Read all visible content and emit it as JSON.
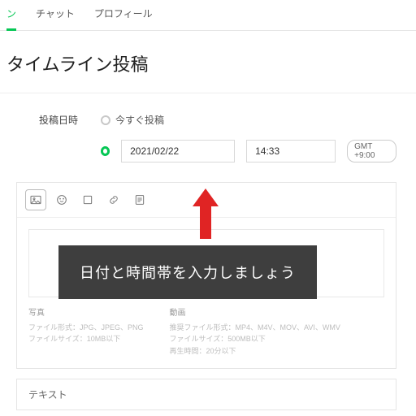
{
  "tabs": {
    "items": [
      "ン",
      "チャット",
      "プロフィール"
    ],
    "active": 0
  },
  "page_title": "タイムライン投稿",
  "post": {
    "label": "投稿日時",
    "option_now": "今すぐ投稿",
    "date": "2021/02/22",
    "time": "14:33",
    "gmt": "GMT +9:00"
  },
  "callout": "日付と時間帯を入力しましょう",
  "media": {
    "photo": {
      "title": "写真",
      "l1": "ファイル形式：JPG、JPEG、PNG",
      "l2": "ファイルサイズ：10MB以下"
    },
    "video": {
      "title": "動画",
      "l1": "推奨ファイル形式：MP4、M4V、MOV、AVI、WMV",
      "l2": "ファイルサイズ：500MB以下",
      "l3": "再生時間：20分以下"
    }
  },
  "text_section": "テキスト",
  "icons": [
    "image",
    "smile",
    "sticker",
    "link",
    "survey"
  ]
}
